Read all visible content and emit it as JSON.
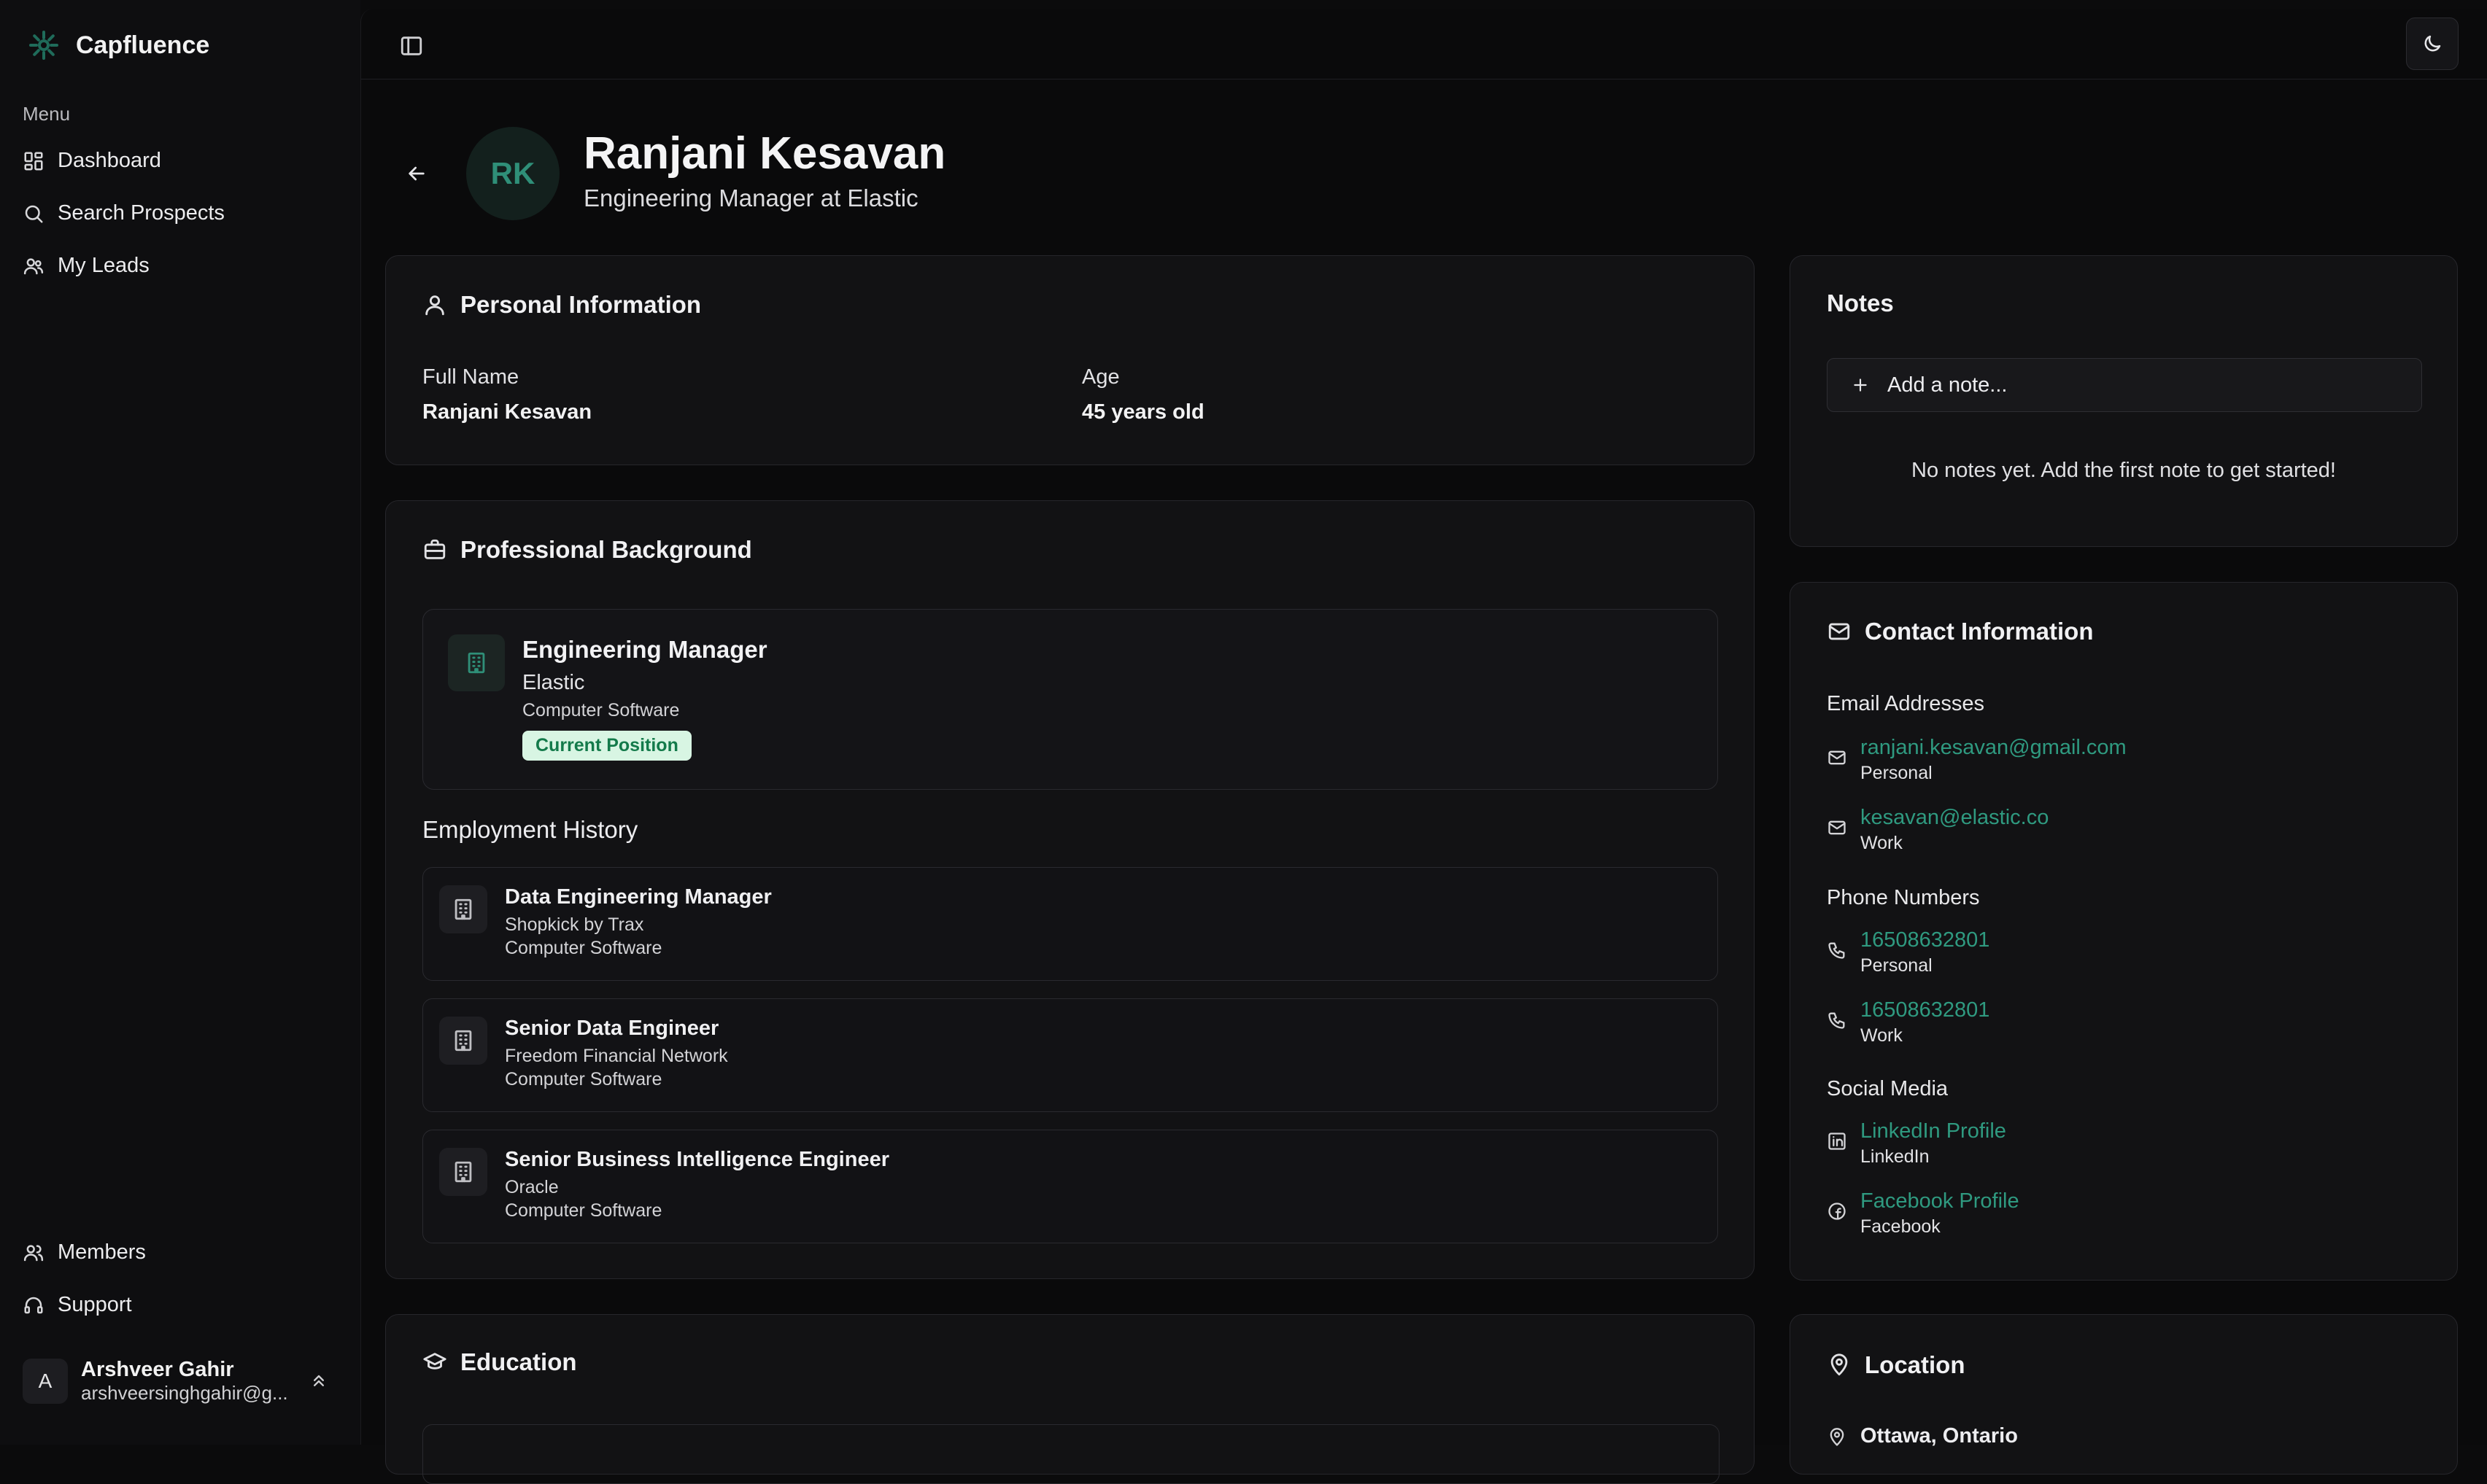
{
  "app": {
    "name": "Capfluence"
  },
  "sidebar": {
    "menu_label": "Menu",
    "items": [
      {
        "label": "Dashboard",
        "icon": "dashboard-icon"
      },
      {
        "label": "Search Prospects",
        "icon": "search-icon"
      },
      {
        "label": "My Leads",
        "icon": "users-icon"
      }
    ],
    "bottom_items": [
      {
        "label": "Members",
        "icon": "users-icon"
      },
      {
        "label": "Support",
        "icon": "headset-icon"
      }
    ],
    "user": {
      "initial": "A",
      "name": "Arshveer Gahir",
      "email": "arshveersinghgahir@g..."
    }
  },
  "profile": {
    "initials": "RK",
    "name": "Ranjani Kesavan",
    "title": "Engineering Manager at Elastic"
  },
  "personal": {
    "title": "Personal Information",
    "full_name_label": "Full Name",
    "full_name": "Ranjani Kesavan",
    "age_label": "Age",
    "age": "45 years old"
  },
  "professional": {
    "title": "Professional Background",
    "current": {
      "role": "Engineering Manager",
      "company": "Elastic",
      "industry": "Computer Software",
      "badge": "Current Position"
    },
    "history_title": "Employment History",
    "history": [
      {
        "role": "Data Engineering Manager",
        "company": "Shopkick by Trax",
        "industry": "Computer Software"
      },
      {
        "role": "Senior Data Engineer",
        "company": "Freedom Financial Network",
        "industry": "Computer Software"
      },
      {
        "role": "Senior Business Intelligence Engineer",
        "company": "Oracle",
        "industry": "Computer Software"
      }
    ]
  },
  "education": {
    "title": "Education"
  },
  "notes": {
    "title": "Notes",
    "add_label": "Add a note...",
    "empty": "No notes yet. Add the first note to get started!"
  },
  "contact": {
    "title": "Contact Information",
    "emails_label": "Email Addresses",
    "emails": [
      {
        "value": "ranjani.kesavan@gmail.com",
        "type": "Personal"
      },
      {
        "value": "kesavan@elastic.co",
        "type": "Work"
      }
    ],
    "phones_label": "Phone Numbers",
    "phones": [
      {
        "value": "16508632801",
        "type": "Personal"
      },
      {
        "value": "16508632801",
        "type": "Work"
      }
    ],
    "social_label": "Social Media",
    "social": [
      {
        "value": "LinkedIn Profile",
        "type": "LinkedIn",
        "icon": "linkedin-icon"
      },
      {
        "value": "Facebook Profile",
        "type": "Facebook",
        "icon": "facebook-icon"
      }
    ]
  },
  "location": {
    "title": "Location",
    "value": "Ottawa, Ontario"
  },
  "colors": {
    "accent": "#2f9a80",
    "badge_bg": "#d8f5e3",
    "badge_text": "#137a4a"
  }
}
